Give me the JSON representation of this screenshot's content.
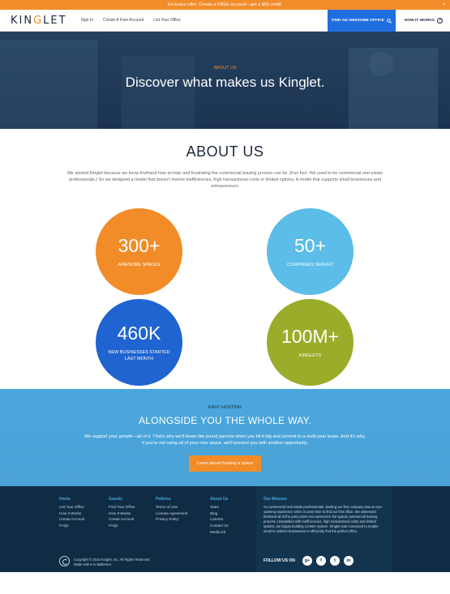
{
  "promo": {
    "text": "Exclusive offer: Create a FREE account—get a $50 credit.",
    "close": "×"
  },
  "nav": {
    "logo_a": "KIN",
    "logo_e": "G",
    "logo_b": "LET",
    "links": [
      "Sign In",
      "Create A Free Account",
      "List Your Office"
    ],
    "find_label": "FIND AN AWESOME OFFICE",
    "how_label": "HOW IT WORKS"
  },
  "hero": {
    "kicker": "ABOUT US",
    "title": "Discover what makes us Kinglet."
  },
  "about": {
    "title": "ABOUT US",
    "body": "We started Kinglet because we know firsthand how archaic and frustrating the commercial leasing process can be. (Fun fact: We used to be commercial real estate professionals.) So we designed a model that doesn't involve inefficiencies, high transactional costs or limited options. A model that supports small businesses and entrepreneurs."
  },
  "stats": [
    {
      "num": "300+",
      "label": "AWESOME SPACES",
      "color": "#f28c28"
    },
    {
      "num": "50+",
      "label": "COMPANIES SERVED",
      "color": "#5bbde8"
    },
    {
      "num": "460K",
      "label": "NEW BUSINESSES STARTED LAST MONTH",
      "color": "#1f64d0"
    },
    {
      "num": "100M+",
      "label": "KINGLETS",
      "color": "#9aac2a"
    }
  ],
  "easy": {
    "kicker": "EASY HOSTING",
    "title": "ALONGSIDE YOU THE WHOLE WAY.",
    "body": "We support your growth—all of it. That's why we'll beam like proud parents when you hit it big and commit to a multi-year lease. And it's why, if you're not using all of your new space, we'll present you with another opportunity.",
    "button": "Learn about hosting a space"
  },
  "footer": {
    "cols": [
      {
        "title": "Hosts",
        "items": [
          "List Your Office",
          "How It Works",
          "Create Account",
          "FAQs"
        ]
      },
      {
        "title": "Guests",
        "items": [
          "Find Your Office",
          "How It Works",
          "Create Account",
          "FAQs"
        ]
      },
      {
        "title": "Policies",
        "items": [
          "Terms of Use",
          "License Agreement",
          "Privacy Policy"
        ]
      },
      {
        "title": "About Us",
        "items": [
          "Team",
          "Blog",
          "Careers",
          "Contact Us",
          "Media Kit"
        ]
      }
    ],
    "mission_title": "Our Mission",
    "mission_text": "As commercial real estate professionals, starting our first company was an eye-opening experience when it came time to find our first office. We witnessed firsthand all of the pain points encountered in the typical commercial leasing process. Unsatisfied with inefficiencies, high transactional costs and limited options, we began building a better system. Kinglet was conceived to enable small to midsize businesses to efficiently find the perfect office.",
    "follow": "FOLLOW US ON",
    "social": [
      "g+",
      "f",
      "t",
      "in"
    ],
    "copyright": "Copyright © 2015 Kinglet, Inc. All Rights Reserved",
    "made": "Made with ♥ in Baltimore."
  }
}
